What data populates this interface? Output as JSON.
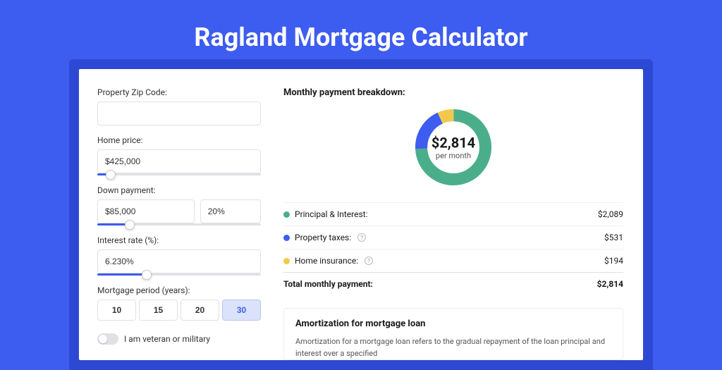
{
  "hero": {
    "title": "Ragland Mortgage Calculator"
  },
  "form": {
    "zip": {
      "label": "Property Zip Code:",
      "value": ""
    },
    "price": {
      "label": "Home price:",
      "value": "$425,000",
      "slider_pct": 8
    },
    "down": {
      "label": "Down payment:",
      "value": "$85,000",
      "pct": "20%",
      "slider_pct": 20
    },
    "rate": {
      "label": "Interest rate (%):",
      "value": "6.230%",
      "slider_pct": 30
    },
    "period": {
      "label": "Mortgage period (years):",
      "options": [
        "10",
        "15",
        "20",
        "30"
      ],
      "selected": "30"
    },
    "veteran": {
      "label": "I am veteran or military",
      "on": false
    }
  },
  "breakdown": {
    "title": "Monthly payment breakdown:",
    "total_value": "$2,814",
    "total_sub": "per month",
    "items": [
      {
        "label": "Principal & Interest:",
        "value": "$2,089",
        "color": "#4bae8b",
        "help": false
      },
      {
        "label": "Property taxes:",
        "value": "$531",
        "color": "#3d5cf0",
        "help": true
      },
      {
        "label": "Home insurance:",
        "value": "$194",
        "color": "#f2c84c",
        "help": true
      }
    ],
    "total_row": {
      "label": "Total monthly payment:",
      "value": "$2,814"
    }
  },
  "chart_data": {
    "type": "pie",
    "title": "Monthly payment breakdown",
    "series": [
      {
        "name": "Principal & Interest",
        "value": 2089,
        "color": "#4bae8b"
      },
      {
        "name": "Property taxes",
        "value": 531,
        "color": "#3d5cf0"
      },
      {
        "name": "Home insurance",
        "value": 194,
        "color": "#f2c84c"
      }
    ],
    "total": 2814,
    "center_label": "$2,814",
    "center_sub": "per month"
  },
  "amortization": {
    "title": "Amortization for mortgage loan",
    "text": "Amortization for a mortgage loan refers to the gradual repayment of the loan principal and interest over a specified"
  }
}
